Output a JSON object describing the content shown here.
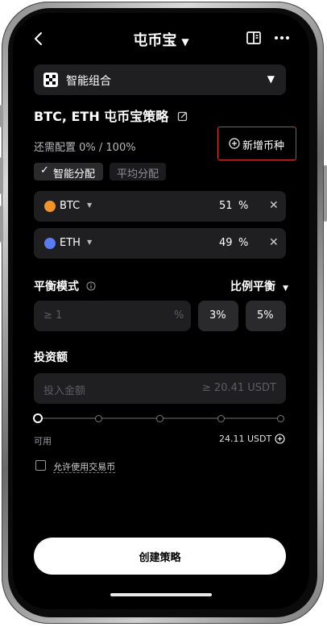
{
  "header": {
    "title": "屯币宝"
  },
  "portfolio_selector": {
    "label": "智能组合"
  },
  "strategy": {
    "title": "BTC, ETH 屯币宝策略"
  },
  "allocation": {
    "remaining": "还需配置 0% / 100%",
    "add_coin_label": "新增币种"
  },
  "alloc_mode": {
    "smart": "智能分配",
    "even": "平均分配"
  },
  "coins": [
    {
      "symbol": "BTC",
      "percent": "51",
      "unit": "%",
      "color": "#f0932b"
    },
    {
      "symbol": "ETH",
      "percent": "49",
      "unit": "%",
      "color": "#5b7cf0"
    }
  ],
  "rebalance": {
    "label": "平衡模式",
    "mode": "比例平衡",
    "input_placeholder": "≥ 1",
    "input_unit": "%",
    "preset_1": "3%",
    "preset_2": "5%"
  },
  "investment": {
    "label": "投资额",
    "placeholder": "投入金额",
    "min_hint": "≥ 20.41 USDT",
    "available_label": "可用",
    "available_value": "24.11 USDT",
    "slider_value": 0
  },
  "checkbox": {
    "label": "允许使用交易币"
  },
  "cta": {
    "label": "创建策略"
  },
  "colors": {
    "accent_border": "#e5352b",
    "card": "#1f1f22",
    "background": "#000000"
  }
}
